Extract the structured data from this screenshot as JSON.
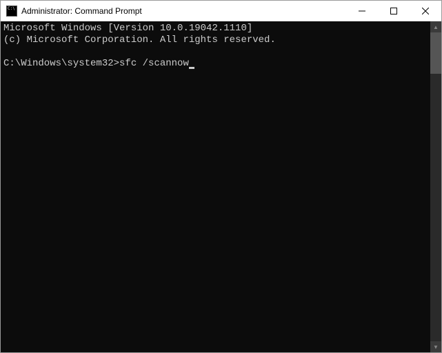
{
  "titlebar": {
    "title": "Administrator: Command Prompt"
  },
  "terminal": {
    "line1": "Microsoft Windows [Version 10.0.19042.1110]",
    "line2": "(c) Microsoft Corporation. All rights reserved.",
    "blank": "",
    "prompt": "C:\\Windows\\system32>",
    "command": "sfc /scannow"
  }
}
